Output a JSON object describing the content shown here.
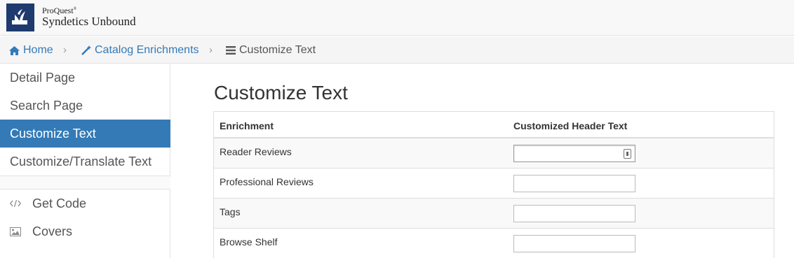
{
  "header": {
    "brand_small": "ProQuest",
    "brand_sup": "®",
    "brand_name": "Syndetics Unbound"
  },
  "breadcrumb": [
    {
      "label": "Home",
      "icon": "home-icon"
    },
    {
      "label": "Catalog Enrichments",
      "icon": "magic-wand-icon"
    },
    {
      "label": "Customize Text",
      "icon": "list-icon"
    }
  ],
  "sidebar": {
    "items": [
      {
        "label": "Detail Page"
      },
      {
        "label": "Search Page"
      },
      {
        "label": "Customize Text",
        "active": true
      },
      {
        "label": "Customize/Translate Text"
      }
    ],
    "tools": [
      {
        "label": "Get Code",
        "icon": "code-icon"
      },
      {
        "label": "Covers",
        "icon": "image-icon"
      }
    ]
  },
  "main": {
    "title": "Customize Text",
    "table": {
      "columns": [
        "Enrichment",
        "Customized Header Text"
      ],
      "rows": [
        {
          "name": "Reader Reviews",
          "value": ""
        },
        {
          "name": "Professional Reviews",
          "value": ""
        },
        {
          "name": "Tags",
          "value": ""
        },
        {
          "name": "Browse Shelf",
          "value": ""
        }
      ]
    }
  },
  "colors": {
    "accent": "#337ab7",
    "logo_bg": "#1e3a6e"
  }
}
